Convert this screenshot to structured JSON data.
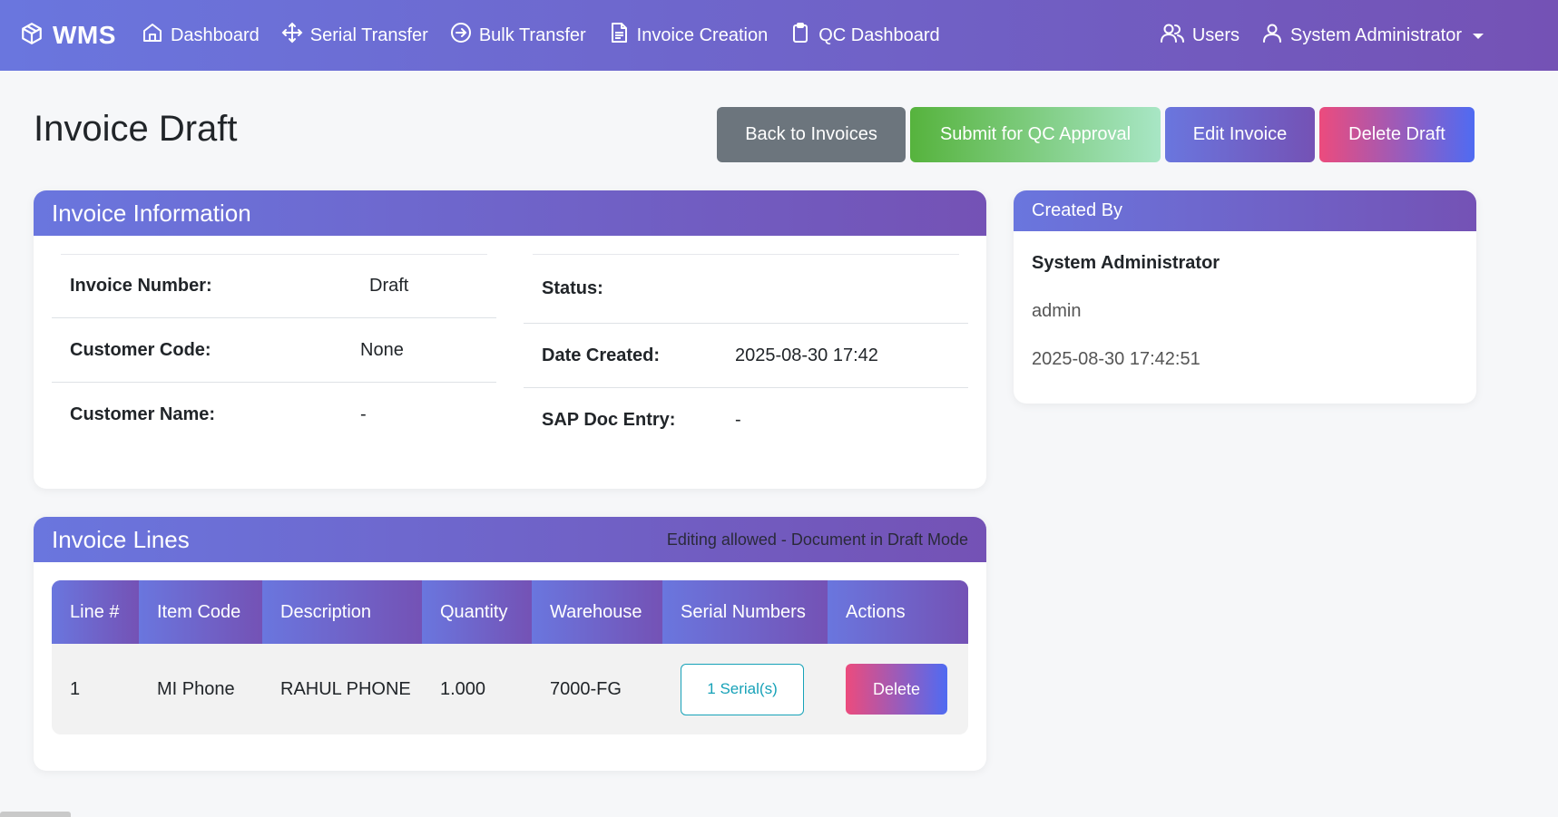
{
  "nav": {
    "brand": "WMS",
    "items": [
      {
        "label": "Dashboard",
        "icon": "home-icon"
      },
      {
        "label": "Serial Transfer",
        "icon": "move-icon"
      },
      {
        "label": "Bulk Transfer",
        "icon": "arrow-circle-icon"
      },
      {
        "label": "Invoice Creation",
        "icon": "file-text-icon"
      },
      {
        "label": "QC Dashboard",
        "icon": "clipboard-icon"
      }
    ],
    "users": "Users",
    "account": "System Administrator"
  },
  "page": {
    "title": "Invoice Draft",
    "buttons": {
      "back": "Back to Invoices",
      "submit": "Submit for QC Approval",
      "edit": "Edit Invoice",
      "delete": "Delete Draft"
    }
  },
  "invoice_info": {
    "title": "Invoice Information",
    "left": [
      {
        "label": "Invoice Number:",
        "value": "Draft"
      },
      {
        "label": "Customer Code:",
        "value": "None"
      },
      {
        "label": "Customer Name:",
        "value": "-"
      }
    ],
    "right": [
      {
        "label": "Status:",
        "value": ""
      },
      {
        "label": "Date Created:",
        "value": "2025-08-30 17:42"
      },
      {
        "label": "SAP Doc Entry:",
        "value": "-"
      }
    ]
  },
  "created_by": {
    "title": "Created By",
    "name": "System Administrator",
    "username": "admin",
    "datetime": "2025-08-30 17:42:51"
  },
  "invoice_lines": {
    "title": "Invoice Lines",
    "note": "Editing allowed - Document in Draft Mode",
    "columns": [
      "Line #",
      "Item Code",
      "Description",
      "Quantity",
      "Warehouse",
      "Serial Numbers",
      "Actions"
    ],
    "rows": [
      {
        "line": "1",
        "item_code": "MI Phone",
        "description": "RAHUL PHONE",
        "quantity": "1.000",
        "warehouse": "7000-FG",
        "serials": "1 Serial(s)",
        "action": "Delete"
      }
    ]
  },
  "colors": {
    "gradient_start": "#6a76de",
    "gradient_end": "#7452b5",
    "back_button": "#6c757d",
    "serial_outline": "#17a2b8"
  }
}
